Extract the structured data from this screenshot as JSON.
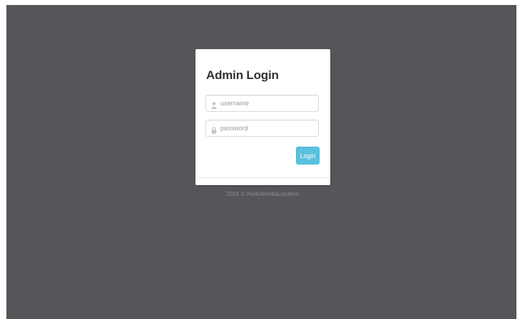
{
  "login": {
    "title": "Admin Login",
    "username": {
      "placeholder": "username",
      "value": "",
      "icon": "user-icon"
    },
    "password": {
      "placeholder": "password",
      "value": "",
      "icon": "lock-icon"
    },
    "submit_label": "Login"
  },
  "footer": {
    "text": "2016 © AsoluteIndiaLocation"
  },
  "colors": {
    "background": "#555659",
    "card": "#ffffff",
    "button": "#5bc0de"
  }
}
